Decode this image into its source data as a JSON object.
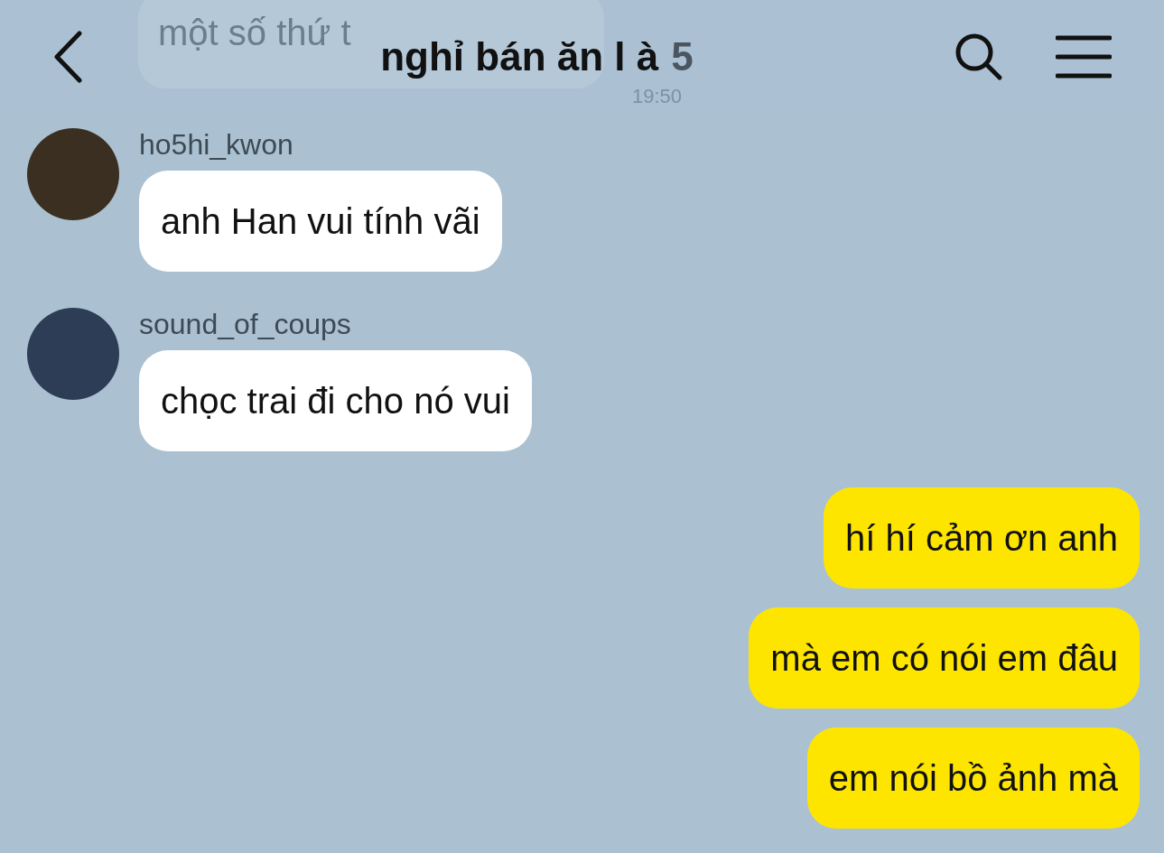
{
  "header": {
    "title": "nghỉ bán ăn l à",
    "member_count": "5"
  },
  "faded_message": {
    "text": "một số thứ t",
    "time": "19:50"
  },
  "messages": [
    {
      "kind": "received",
      "sender": "ho5hi_kwon",
      "text": "anh Han vui tính vãi"
    },
    {
      "kind": "received",
      "sender": "sound_of_coups",
      "text": "chọc trai đi cho nó vui"
    },
    {
      "kind": "sent",
      "text": "hí hí cảm ơn anh"
    },
    {
      "kind": "sent",
      "text": "mà em có nói em đâu"
    },
    {
      "kind": "sent",
      "text": "em nói bồ ảnh mà"
    }
  ]
}
